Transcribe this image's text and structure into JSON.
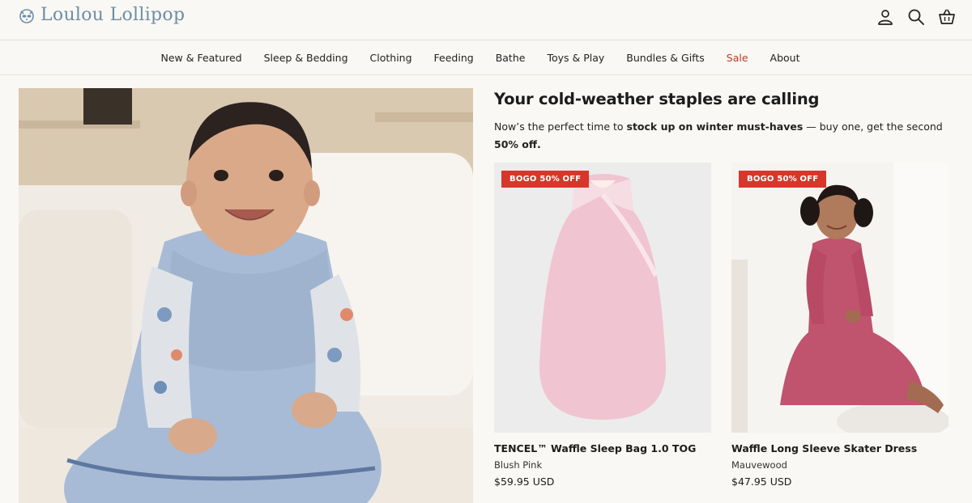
{
  "header": {
    "brand": "Loulou Lollipop",
    "icons": [
      "account-icon",
      "search-icon",
      "cart-icon"
    ]
  },
  "nav": {
    "items": [
      "New & Featured",
      "Sleep & Bedding",
      "Clothing",
      "Feeding",
      "Bathe",
      "Toys & Play",
      "Bundles & Gifts",
      "Sale",
      "About"
    ]
  },
  "promo": {
    "title": "Your cold-weather staples are calling",
    "text_pre": "Now’s the perfect time to ",
    "text_bold": "stock up on winter must-haves",
    "text_post": " — buy one, get the second ",
    "text_bold2": "50% off."
  },
  "products": [
    {
      "badge": "BOGO 50% OFF",
      "name": "TENCEL™ Waffle Sleep Bag 1.0 TOG",
      "variant": "Blush Pink",
      "price": "$59.95 USD"
    },
    {
      "badge": "BOGO 50% OFF",
      "name": "Waffle Long Sleeve Skater Dress",
      "variant": "Mauvewood",
      "price": "$47.95 USD"
    }
  ],
  "colors": {
    "brand": "#6b8fa8",
    "sale": "#c0392b",
    "badge": "#d6372a",
    "background": "#faf8f4"
  }
}
